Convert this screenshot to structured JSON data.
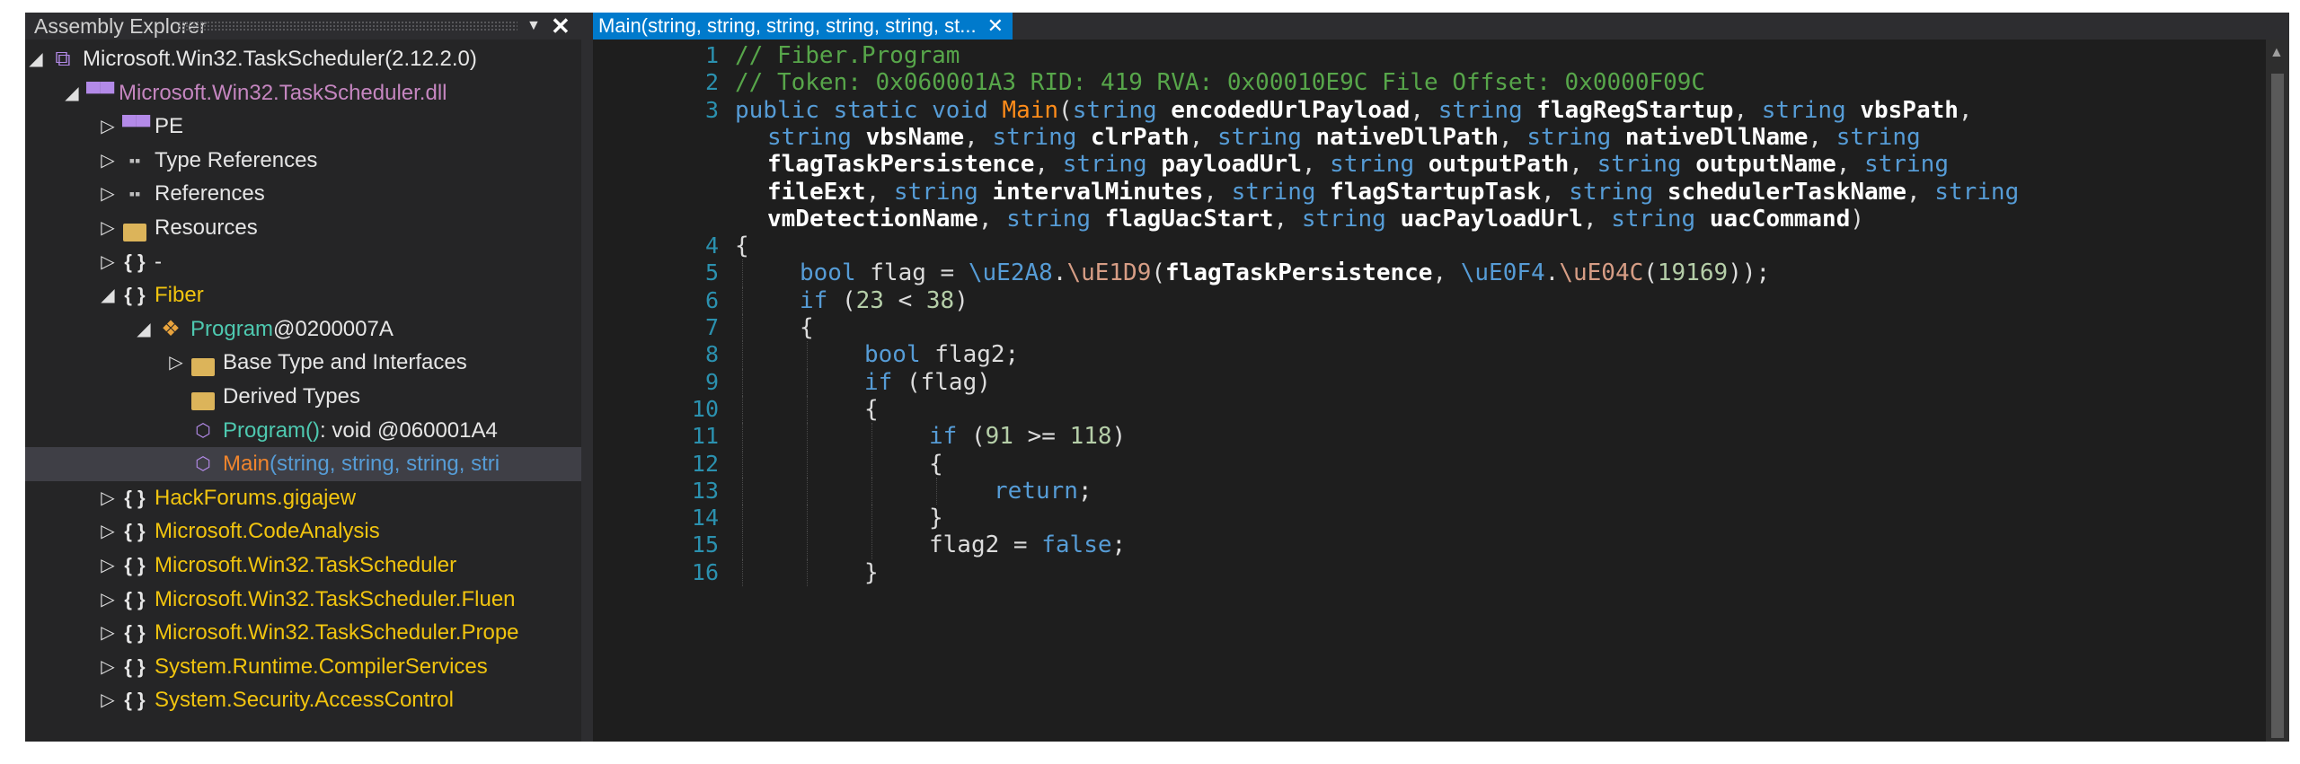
{
  "left_panel": {
    "title": "Assembly Explorer",
    "pin_glyph": "▼",
    "close_glyph": "✕",
    "tree": [
      {
        "level": 0,
        "expanded": true,
        "icon": "assembly-icon",
        "label": "Microsoft.Win32.TaskScheduler (2.12.2.0)",
        "color": "white"
      },
      {
        "level": 1,
        "expanded": true,
        "icon": "dll-icon",
        "label": "Microsoft.Win32.TaskScheduler.dll",
        "color": "purple"
      },
      {
        "level": 2,
        "expanded": false,
        "icon": "dll-icon",
        "label": "PE",
        "color": "white"
      },
      {
        "level": 2,
        "expanded": false,
        "icon": "references-icon",
        "label": "Type References",
        "color": "white"
      },
      {
        "level": 2,
        "expanded": false,
        "icon": "references-icon",
        "label": "References",
        "color": "white"
      },
      {
        "level": 2,
        "expanded": false,
        "icon": "folder-icon",
        "label": "Resources",
        "color": "white"
      },
      {
        "level": 2,
        "expanded": false,
        "icon": "namespace-icon",
        "label": "-",
        "color": "white"
      },
      {
        "level": 2,
        "expanded": true,
        "icon": "namespace-icon",
        "label": "Fiber",
        "color": "yellow"
      },
      {
        "level": 3,
        "expanded": true,
        "icon": "class-icon",
        "label": "Program @0200007A",
        "color": "teal"
      },
      {
        "level": 4,
        "expanded": false,
        "icon": "folder-icon",
        "label": "Base Type and Interfaces",
        "color": "white"
      },
      {
        "level": 4,
        "expanded": null,
        "icon": "folder-icon",
        "label": "Derived Types",
        "color": "white"
      },
      {
        "level": 4,
        "expanded": null,
        "icon": "method-icon",
        "label": "Program() : void @060001A4",
        "color": "teal"
      },
      {
        "level": 4,
        "expanded": null,
        "icon": "method-icon",
        "label": "Main(string, string, string, stri",
        "color": "orange",
        "selected": true
      },
      {
        "level": 2,
        "expanded": false,
        "icon": "namespace-icon",
        "label": "HackForums.gigajew",
        "color": "yellow"
      },
      {
        "level": 2,
        "expanded": false,
        "icon": "namespace-icon",
        "label": "Microsoft.CodeAnalysis",
        "color": "yellow"
      },
      {
        "level": 2,
        "expanded": false,
        "icon": "namespace-icon",
        "label": "Microsoft.Win32.TaskScheduler",
        "color": "yellow"
      },
      {
        "level": 2,
        "expanded": false,
        "icon": "namespace-icon",
        "label": "Microsoft.Win32.TaskScheduler.Fluen",
        "color": "yellow"
      },
      {
        "level": 2,
        "expanded": false,
        "icon": "namespace-icon",
        "label": "Microsoft.Win32.TaskScheduler.Prope",
        "color": "yellow"
      },
      {
        "level": 2,
        "expanded": false,
        "icon": "namespace-icon",
        "label": "System.Runtime.CompilerServices",
        "color": "yellow"
      },
      {
        "level": 2,
        "expanded": false,
        "icon": "namespace-icon",
        "label": "System.Security.AccessControl",
        "color": "yellow"
      }
    ]
  },
  "editor": {
    "tab_label": "Main(string, string, string, string, string, st...",
    "tab_close": "✕",
    "lines": [
      {
        "num": "1",
        "tokens": [
          [
            "cm",
            "// Fiber.Program"
          ]
        ]
      },
      {
        "num": "2",
        "tokens": [
          [
            "cm",
            "// Token: 0x060001A3 RID: 419 RVA: 0x00010E9C File Offset: 0x0000F09C"
          ]
        ]
      },
      {
        "num": "3",
        "tokens": [
          [
            "k",
            "public static void "
          ],
          [
            "m",
            "Main"
          ],
          [
            "p",
            "("
          ],
          [
            "k",
            "string "
          ],
          [
            "b",
            "encodedUrlPayload"
          ],
          [
            "p",
            ", "
          ],
          [
            "k",
            "string "
          ],
          [
            "b",
            "flagRegStartup"
          ],
          [
            "p",
            ", "
          ],
          [
            "k",
            "string "
          ],
          [
            "b",
            "vbsPath"
          ],
          [
            "p",
            ","
          ]
        ]
      },
      {
        "num": "",
        "indent": 1,
        "tokens": [
          [
            "k",
            "string "
          ],
          [
            "b",
            "vbsName"
          ],
          [
            "p",
            ", "
          ],
          [
            "k",
            "string "
          ],
          [
            "b",
            "clrPath"
          ],
          [
            "p",
            ", "
          ],
          [
            "k",
            "string "
          ],
          [
            "b",
            "nativeDllPath"
          ],
          [
            "p",
            ", "
          ],
          [
            "k",
            "string "
          ],
          [
            "b",
            "nativeDllName"
          ],
          [
            "p",
            ", "
          ],
          [
            "k",
            "string"
          ]
        ]
      },
      {
        "num": "",
        "indent": 1,
        "tokens": [
          [
            "b",
            "flagTaskPersistence"
          ],
          [
            "p",
            ", "
          ],
          [
            "k",
            "string "
          ],
          [
            "b",
            "payloadUrl"
          ],
          [
            "p",
            ", "
          ],
          [
            "k",
            "string "
          ],
          [
            "b",
            "outputPath"
          ],
          [
            "p",
            ", "
          ],
          [
            "k",
            "string "
          ],
          [
            "b",
            "outputName"
          ],
          [
            "p",
            ", "
          ],
          [
            "k",
            "string"
          ]
        ]
      },
      {
        "num": "",
        "indent": 1,
        "tokens": [
          [
            "b",
            "fileExt"
          ],
          [
            "p",
            ", "
          ],
          [
            "k",
            "string "
          ],
          [
            "b",
            "intervalMinutes"
          ],
          [
            "p",
            ", "
          ],
          [
            "k",
            "string "
          ],
          [
            "b",
            "flagStartupTask"
          ],
          [
            "p",
            ", "
          ],
          [
            "k",
            "string "
          ],
          [
            "b",
            "schedulerTaskName"
          ],
          [
            "p",
            ", "
          ],
          [
            "k",
            "string"
          ]
        ]
      },
      {
        "num": "",
        "indent": 1,
        "tokens": [
          [
            "b",
            "vmDetectionName"
          ],
          [
            "p",
            ", "
          ],
          [
            "k",
            "string "
          ],
          [
            "b",
            "flagUacStart"
          ],
          [
            "p",
            ", "
          ],
          [
            "k",
            "string "
          ],
          [
            "b",
            "uacPayloadUrl"
          ],
          [
            "p",
            ", "
          ],
          [
            "k",
            "string "
          ],
          [
            "b",
            "uacCommand"
          ],
          [
            "p",
            ")"
          ]
        ]
      },
      {
        "num": "4",
        "tokens": [
          [
            "p",
            "{"
          ]
        ]
      },
      {
        "num": "5",
        "indent": 1,
        "tokens": [
          [
            "k",
            "bool "
          ],
          [
            "p",
            "flag = "
          ],
          [
            "k",
            "\\uE2A8"
          ],
          [
            "p",
            "."
          ],
          [
            "u",
            "\\uE1D9"
          ],
          [
            "p",
            "("
          ],
          [
            "b",
            "flagTaskPersistence"
          ],
          [
            "p",
            ", "
          ],
          [
            "k",
            "\\uE0F4"
          ],
          [
            "p",
            "."
          ],
          [
            "u",
            "\\uE04C"
          ],
          [
            "p",
            "("
          ],
          [
            "n",
            "19169"
          ],
          [
            "p",
            "));"
          ]
        ]
      },
      {
        "num": "6",
        "indent": 1,
        "tokens": [
          [
            "k",
            "if "
          ],
          [
            "p",
            "("
          ],
          [
            "n",
            "23"
          ],
          [
            "p",
            " < "
          ],
          [
            "n",
            "38"
          ],
          [
            "p",
            ")"
          ]
        ]
      },
      {
        "num": "7",
        "indent": 1,
        "tokens": [
          [
            "p",
            "{"
          ]
        ]
      },
      {
        "num": "8",
        "indent": 2,
        "tokens": [
          [
            "k",
            "bool "
          ],
          [
            "p",
            "flag2;"
          ]
        ]
      },
      {
        "num": "9",
        "indent": 2,
        "tokens": [
          [
            "k",
            "if "
          ],
          [
            "p",
            "(flag)"
          ]
        ]
      },
      {
        "num": "10",
        "indent": 2,
        "tokens": [
          [
            "p",
            "{"
          ]
        ]
      },
      {
        "num": "11",
        "indent": 3,
        "tokens": [
          [
            "k",
            "if "
          ],
          [
            "p",
            "("
          ],
          [
            "n",
            "91"
          ],
          [
            "p",
            " >= "
          ],
          [
            "n",
            "118"
          ],
          [
            "p",
            ")"
          ]
        ]
      },
      {
        "num": "12",
        "indent": 3,
        "tokens": [
          [
            "p",
            "{"
          ]
        ]
      },
      {
        "num": "13",
        "indent": 4,
        "tokens": [
          [
            "k",
            "return"
          ],
          [
            "p",
            ";"
          ]
        ]
      },
      {
        "num": "14",
        "indent": 3,
        "tokens": [
          [
            "p",
            "}"
          ]
        ]
      },
      {
        "num": "15",
        "indent": 3,
        "tokens": [
          [
            "p",
            "flag2 = "
          ],
          [
            "k",
            "false"
          ],
          [
            "p",
            ";"
          ]
        ]
      },
      {
        "num": "16",
        "indent": 2,
        "tokens": [
          [
            "p",
            "}"
          ]
        ]
      }
    ]
  },
  "colors": {
    "background": "#1e1e1e",
    "tab_active": "#007acc",
    "keyword": "#569cd6",
    "comment": "#57a64a",
    "method": "#ff8c1a",
    "line_number": "#2b91af",
    "selection": "#3f3f46"
  }
}
